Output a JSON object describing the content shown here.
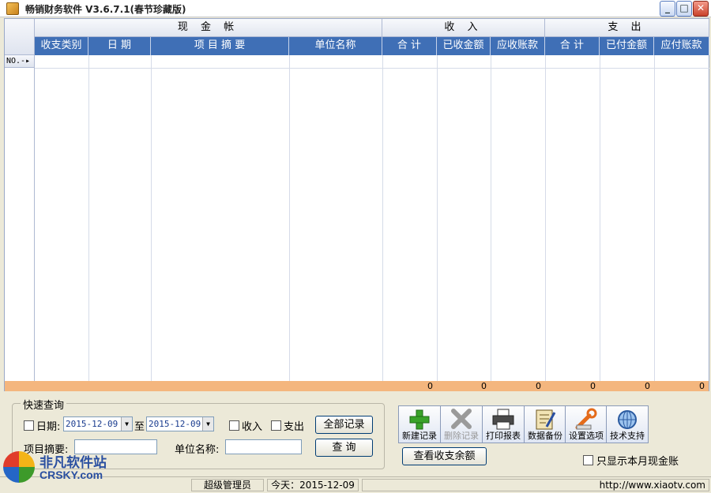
{
  "window": {
    "title": "畅销财务软件 V3.6.7.1(春节珍藏版)",
    "minimize_glyph": "_",
    "maximize_glyph": "□",
    "close_glyph": "✕"
  },
  "grid": {
    "groups": [
      "现 金 帐",
      "收 入",
      "支 出"
    ],
    "columns": [
      "收支类别",
      "日 期",
      "项 目 摘 要",
      "单位名称",
      "合 计",
      "已收金额",
      "应收账款",
      "合 计",
      "已付金额",
      "应付账款"
    ],
    "row_header": "NO.-▸",
    "totals": [
      "0",
      "0",
      "0",
      "0",
      "0",
      "0"
    ],
    "header_color": "#3f6fb6",
    "totals_color": "#f4b67e"
  },
  "quick_search": {
    "title": "快速查询",
    "date_label": "日期:",
    "date_from": "2015-12-09",
    "to_label": "至",
    "date_to": "2015-12-09",
    "income_label": "收入",
    "expense_label": "支出",
    "all_records_button": "全部记录",
    "summary_label": "项目摘要:",
    "unit_label": "单位名称:",
    "query_button": "查 询"
  },
  "toolbar": {
    "new_record": "新建记录",
    "delete_record": "删除记录",
    "print_report": "打印报表",
    "backup": "数据备份",
    "settings": "设置选项",
    "support": "技术支持",
    "balance_button": "查看收支余额",
    "month_only_label": "只显示本月现金账"
  },
  "status": {
    "user": "超级管理员",
    "today": "今天：2015-12-09",
    "url": "http://www.xiaotv.com"
  },
  "watermark": {
    "line1": "非凡软件站",
    "line2": "CRSKY.com"
  }
}
